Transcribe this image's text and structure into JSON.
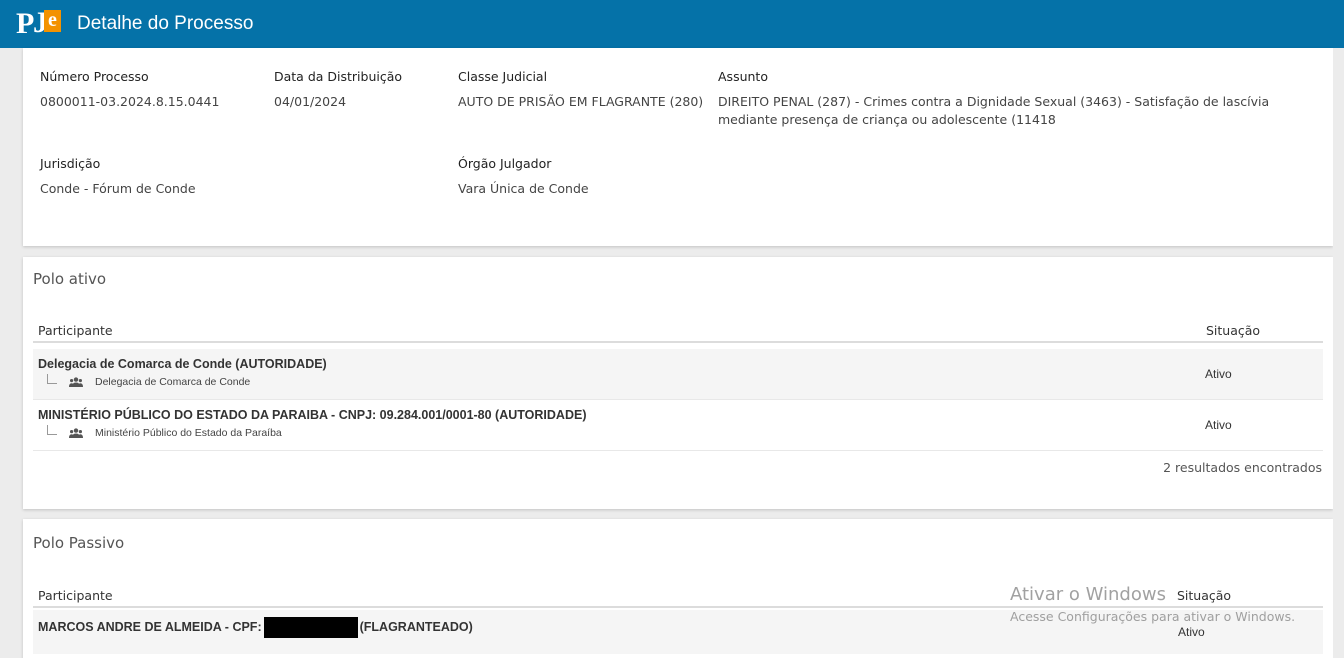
{
  "app": {
    "title": "Detalhe do Processo",
    "logo": {
      "p": "P",
      "j": "J",
      "e": "e"
    }
  },
  "process": {
    "numero": {
      "label": "Número Processo",
      "value": "0800011-03.2024.8.15.0441"
    },
    "data_distribuicao": {
      "label": "Data da Distribuição",
      "value": "04/01/2024"
    },
    "classe": {
      "label": "Classe Judicial",
      "value": "AUTO DE PRISÃO EM FLAGRANTE (280)"
    },
    "assunto": {
      "label": "Assunto",
      "value": "DIREITO PENAL (287) - Crimes contra a Dignidade Sexual (3463) - Satisfação de lascívia mediante presença de criança ou adolescente (11418"
    },
    "jurisdicao": {
      "label": "Jurisdição",
      "value": "Conde - Fórum de Conde"
    },
    "orgao": {
      "label": "Órgão Julgador",
      "value": "Vara Única de Conde"
    }
  },
  "polo_ativo": {
    "title": "Polo ativo",
    "col_participante": "Participante",
    "col_situacao": "Situação",
    "rows": [
      {
        "name": "Delegacia de Comarca de Conde (AUTORIDADE)",
        "sub": "Delegacia de Comarca de Conde",
        "status": "Ativo"
      },
      {
        "name": "MINISTÉRIO PÚBLICO DO ESTADO DA PARAIBA - CNPJ: 09.284.001/0001-80 (AUTORIDADE)",
        "sub": "Ministério Público do Estado da Paraíba",
        "status": "Ativo"
      }
    ],
    "results": "2 resultados encontrados"
  },
  "polo_passivo": {
    "title": "Polo Passivo",
    "col_participante": "Participante",
    "col_situacao": "Situação",
    "rows": [
      {
        "name_prefix": "MARCOS ANDRE DE ALMEIDA - CPF:",
        "name_suffix": "(FLAGRANTEADO)",
        "status": "Ativo"
      }
    ]
  },
  "watermark": {
    "title": "Ativar o Windows",
    "subtitle": "Acesse Configurações para ativar o Windows."
  },
  "colors": {
    "topbar": "#0572a8",
    "logo_accent": "#f39200"
  },
  "icons": {
    "group": "users-icon"
  }
}
